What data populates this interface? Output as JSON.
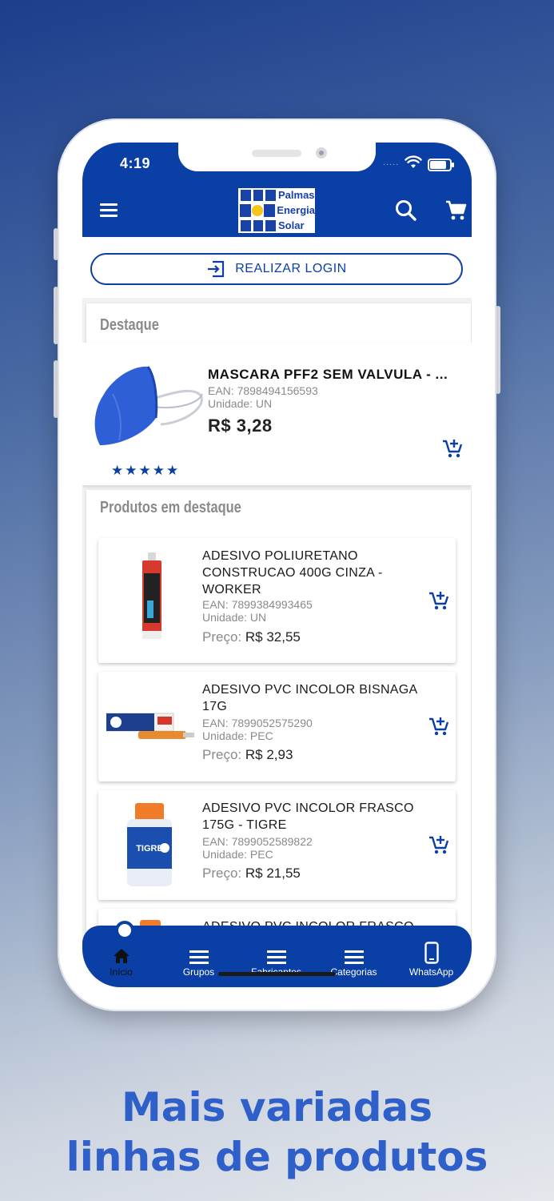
{
  "status": {
    "time": "4:19",
    "dots": "....."
  },
  "header": {
    "logo_lines": [
      "Palmas",
      "Energia",
      "Solar"
    ],
    "login_label": "REALIZAR LOGIN"
  },
  "featured": {
    "section_title": "Destaque",
    "product": {
      "name": "MASCARA PFF2 SEM VALVULA - ...",
      "ean": "EAN: 7898494156593",
      "unit": "Unidade: UN",
      "price": "R$ 3,28",
      "stars": "★★★★★",
      "rating": 5
    }
  },
  "products_section": {
    "title": "Produtos em destaque",
    "price_label": "Preço:",
    "items": [
      {
        "name": "ADESIVO POLIURETANO CONSTRUCAO 400G CINZA - WORKER",
        "ean": "EAN: 7899384993465",
        "unit": "Unidade: UN",
        "price": "R$ 32,55"
      },
      {
        "name": "ADESIVO PVC INCOLOR BISNAGA 17G",
        "ean": "EAN: 7899052575290",
        "unit": "Unidade: PEC",
        "price": "R$ 2,93"
      },
      {
        "name": "ADESIVO PVC INCOLOR FRASCO 175G - TIGRE",
        "ean": "EAN: 7899052589822",
        "unit": "Unidade: PEC",
        "price": "R$ 21,55"
      },
      {
        "name": "ADESIVO PVC INCOLOR FRASCO"
      }
    ]
  },
  "bottom_nav": [
    {
      "label": "Início"
    },
    {
      "label": "Grupos"
    },
    {
      "label": "Fabricantes"
    },
    {
      "label": "Categorias"
    },
    {
      "label": "WhatsApp"
    }
  ],
  "tagline": [
    "Mais variadas",
    "linhas de produtos"
  ],
  "colors": {
    "primary": "#0a3fa5",
    "tagline": "#2f5fc8",
    "sun": "#f5c518"
  }
}
